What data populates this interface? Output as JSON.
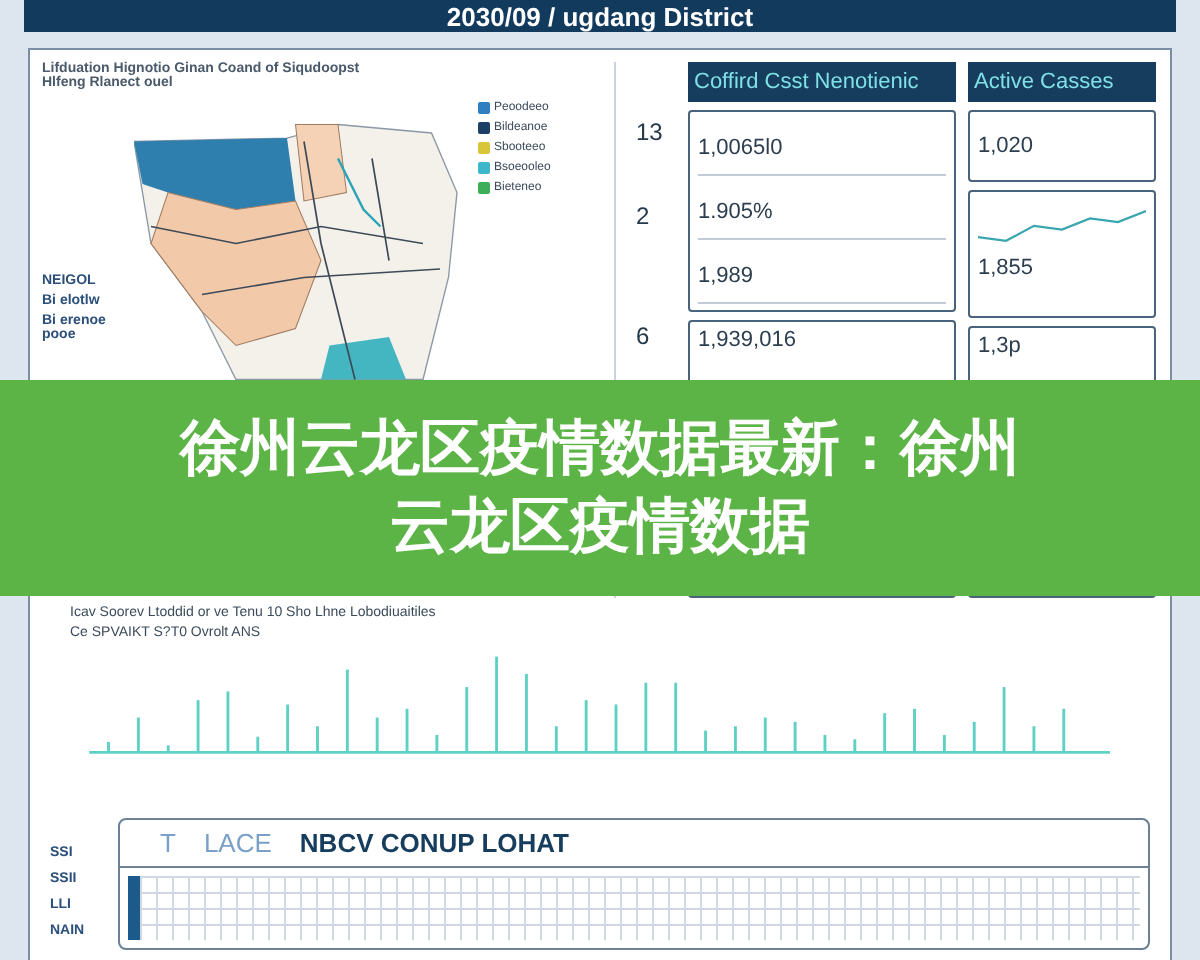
{
  "header": {
    "title": "2030/09 / ugdang District"
  },
  "map": {
    "caption": [
      "Lifduation Hignotio Ginan Coand of Siqudoopst",
      "Hlfeng Rlanect ouel"
    ],
    "labels": [
      "NEIGOL",
      "Bi elotlw",
      "Bi erenoe pooe"
    ],
    "legend": [
      {
        "label": "Peoodeeo",
        "color": "#2f7fc1"
      },
      {
        "label": "Bildeanoe",
        "color": "#1b3f66"
      },
      {
        "label": "Sbooteeo",
        "color": "#d9c53a"
      },
      {
        "label": "Bsoeooleo",
        "color": "#3bb7c9"
      },
      {
        "label": "Bieteneo",
        "color": "#3fae5a"
      }
    ]
  },
  "side_numbers": [
    "13",
    "2",
    "6"
  ],
  "cases_card": {
    "title": "Coffird Csst Nenotienic",
    "values": [
      "1,0065l0",
      "1.905%",
      "1,989"
    ],
    "lower_value": "1,939,016"
  },
  "active_card": {
    "title": "Active Casses",
    "values": [
      "1,020",
      "1,855"
    ],
    "lower_value": "1,3p"
  },
  "chart": {
    "title": "Icav Soorev Ltoddid or ve Tenu 10 Sho Lhne Lobodiuaitiles",
    "subtitle": "Ce SPVAIKT S?T0 Ovrolt ANS"
  },
  "table": {
    "row_labels": [
      "SSI",
      "SSII",
      "LLI",
      "NAIN"
    ],
    "tabs": [
      {
        "label": "T",
        "selected": false
      },
      {
        "label": "LACE",
        "selected": false
      }
    ],
    "title": "NBCV CONUP LOHAT"
  },
  "overlay": {
    "lines": [
      "徐州云龙区疫情数据最新：徐州",
      "云龙区疫情数据"
    ]
  }
}
